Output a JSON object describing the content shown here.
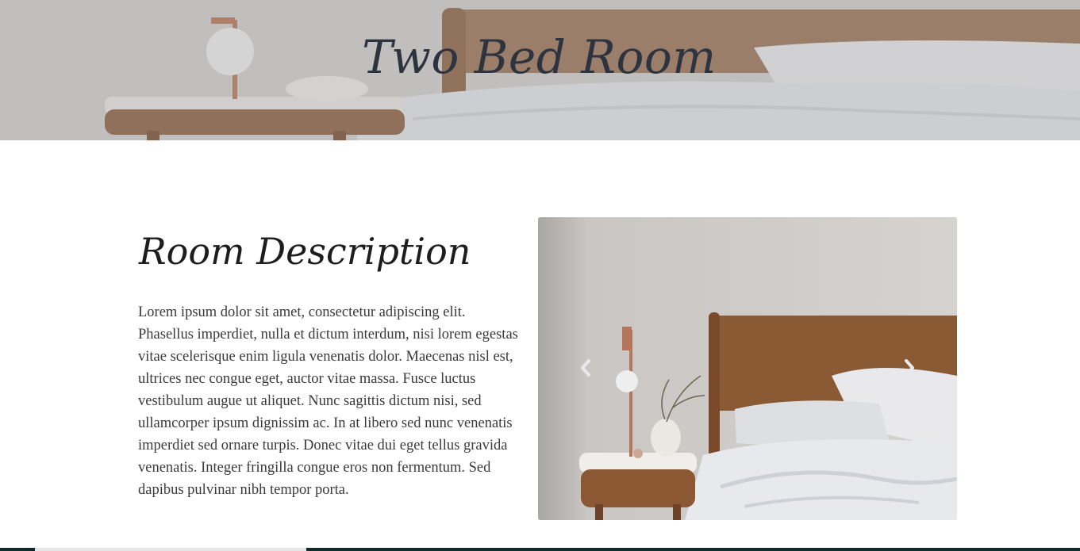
{
  "hero": {
    "title": "Two Bed Room"
  },
  "room": {
    "heading": "Room Description",
    "description": "Lorem ipsum dolor sit amet, consectetur adipiscing elit. Phasellus imperdiet, nulla et dictum interdum, nisi lorem egestas vitae scelerisque enim ligula venenatis dolor. Maecenas nisl est, ultrices nec congue eget, auctor vitae massa. Fusce luctus vestibulum augue ut aliquet. Nunc sagittis dictum nisi, sed ullamcorper ipsum dignissim ac. In at libero sed nunc venenatis imperdiet sed ornare turpis. Donec vitae dui eget tellus gravida venenatis. Integer fringilla congue eros non fermentum. Sed dapibus pulvinar nibh tempor porta."
  },
  "carousel": {
    "prev_icon": "chevron-left-icon",
    "next_icon": "chevron-right-icon"
  },
  "colors": {
    "hero_title": "#2d3440",
    "heading": "#1d1d1d",
    "body_text": "#3a3a3a",
    "wood": "#8a5a34",
    "bottom_strip": "#0f2a2a"
  }
}
